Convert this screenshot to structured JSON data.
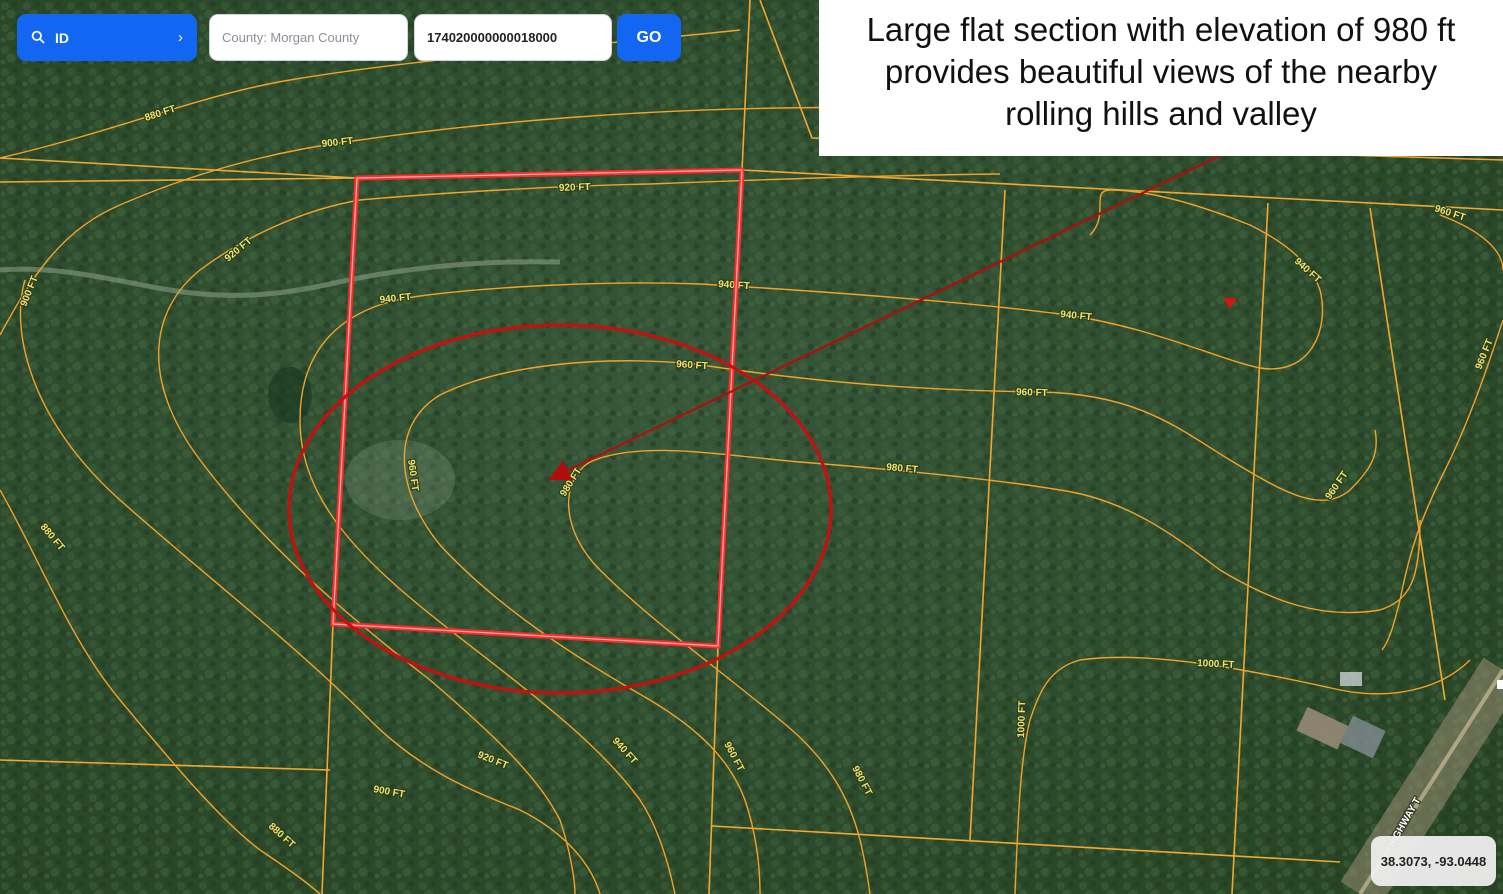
{
  "toolbar": {
    "search_label": "ID",
    "search_icon": "search-icon",
    "chevron_icon": "chevron-right-icon",
    "county_placeholder": "County: Morgan County",
    "county_value": "",
    "parcel_value": "174020000000018000",
    "go_label": "GO",
    "accent_color": "#1266f1"
  },
  "callout": {
    "lines": [
      "Large flat section with elevation of 980 ft",
      "provides beautiful views of the nearby",
      "rolling hills and valley"
    ]
  },
  "contour_labels": [
    "880 FT",
    "900 FT",
    "920 FT",
    "940 FT",
    "960 FT",
    "980 FT",
    "1000 FT",
    "960 FT",
    "980 FT"
  ],
  "labels": {
    "l880a": "880 FT",
    "l900a": "900 FT",
    "l920a": "920 FT",
    "l920b": "920 FT",
    "l900b": "900 FT",
    "l940a": "940 FT",
    "l940b": "940 FT",
    "l940c": "940 FT",
    "l940d": "940 FT",
    "l960a": "960 FT",
    "l960b": "960 FT",
    "l960c": "960 FT",
    "l960d": "960 FT",
    "l960e": "960 FT",
    "l960f": "960 FT",
    "l980a": "980 FT",
    "l980b": "980 FT",
    "l980c": "980 FT",
    "l980d": "980 FT",
    "l1000a": "1000 FT",
    "l1000b": "1000 FT",
    "l880b": "880 FT",
    "l880c": "880 FT",
    "l920c": "920 FT",
    "l900c": "900 FT",
    "l940e": "940 FT",
    "highway": "HIGHWAY T"
  },
  "coords": "38.3073, -93.0448",
  "colors": {
    "contour": "#f2a22a",
    "parcel_highlight": "#ff2a2a",
    "circle": "#c80f0f",
    "arrow": "#b00d0d",
    "parcel_lines": "#f2a830"
  }
}
